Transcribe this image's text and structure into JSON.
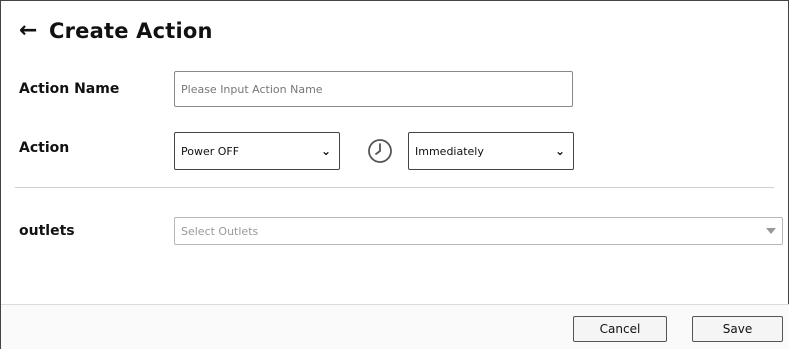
{
  "header": {
    "back_icon": "←",
    "title": "Create Action"
  },
  "form": {
    "action_name": {
      "label": "Action Name",
      "placeholder": "Please Input Action Name",
      "value": ""
    },
    "action": {
      "label": "Action",
      "selected": "Power OFF",
      "timing_selected": "Immediately",
      "clock_icon": "clock-icon"
    },
    "outlets": {
      "label": "outlets",
      "placeholder": "Select Outlets"
    }
  },
  "footer": {
    "cancel_label": "Cancel",
    "save_label": "Save"
  }
}
